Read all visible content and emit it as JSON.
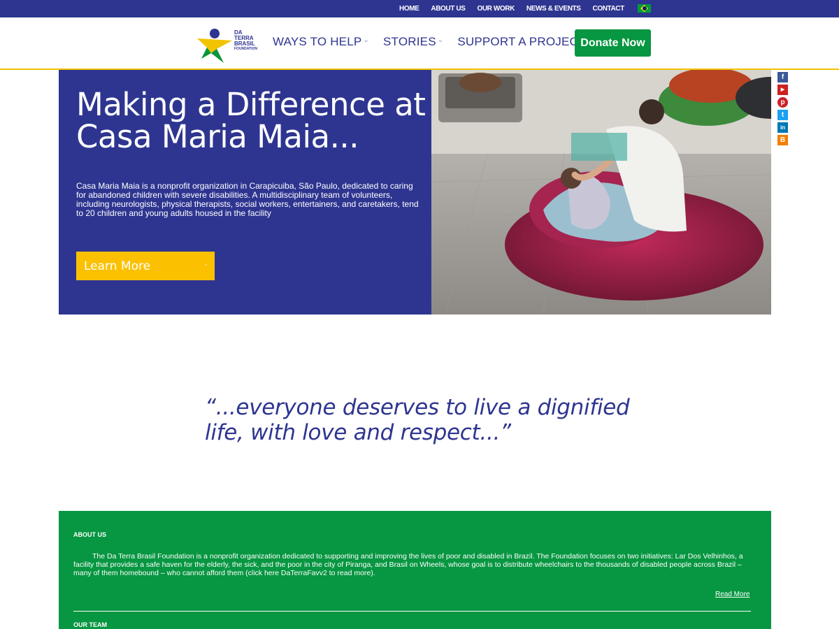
{
  "topnav": {
    "items": [
      "HOME",
      "ABOUT US",
      "OUR WORK",
      "NEWS & EVENTS",
      "CONTACT"
    ]
  },
  "logo": {
    "line1": "DA",
    "line2": "TERRA",
    "line3": "BRASIL",
    "line4": "FOUNDATION"
  },
  "mainnav": {
    "items": [
      "WAYS TO HELP",
      "STORIES",
      "SUPPORT A PROJECT"
    ]
  },
  "donate_label": "Donate Now",
  "hero": {
    "title": "Making a Difference at Casa Maria Maia...",
    "description": "Casa Maria Maia is a nonprofit organization in Carapicuiba, São Paulo, dedicated to caring for abandoned children with severe disabilities. A multidisciplinary team of volunteers, including neurologists, physical therapists, social workers, entertainers, and caretakers, tend to 20 children and young adults housed in the facility",
    "button": "Learn More"
  },
  "social": {
    "icons": [
      "facebook-icon",
      "youtube-icon",
      "pinterest-icon",
      "twitter-icon",
      "linkedin-icon",
      "blogger-icon"
    ],
    "colors": [
      "#3b5998",
      "#cd201f",
      "#cb2027",
      "#1da1f2",
      "#0077b5",
      "#f57d00"
    ]
  },
  "quote": "“...everyone deserves to live a dignified life, with love and respect...”",
  "about": {
    "heading": "ABOUT US",
    "text": "The Da Terra Brasil Foundation is a nonprofit organization dedicated to supporting and improving the lives of poor and disabled in Brazil. The Foundation focuses on two initiatives: Lar Dos Velhinhos, a facility that provides a safe haven for the elderly, the sick, and the poor in the city of Piranga, and Brasil on Wheels, whose goal is to distribute wheelchairs to the thousands of disabled people across Brazil – many of them homebound – who cannot afford them (click here DaTerraFavv2 to read more).",
    "read_more": "Read More",
    "team_heading": "OUR TEAM"
  },
  "colors": {
    "brand_blue": "#2e3590",
    "brand_green": "#079641",
    "accent_yellow": "#fbc101"
  }
}
